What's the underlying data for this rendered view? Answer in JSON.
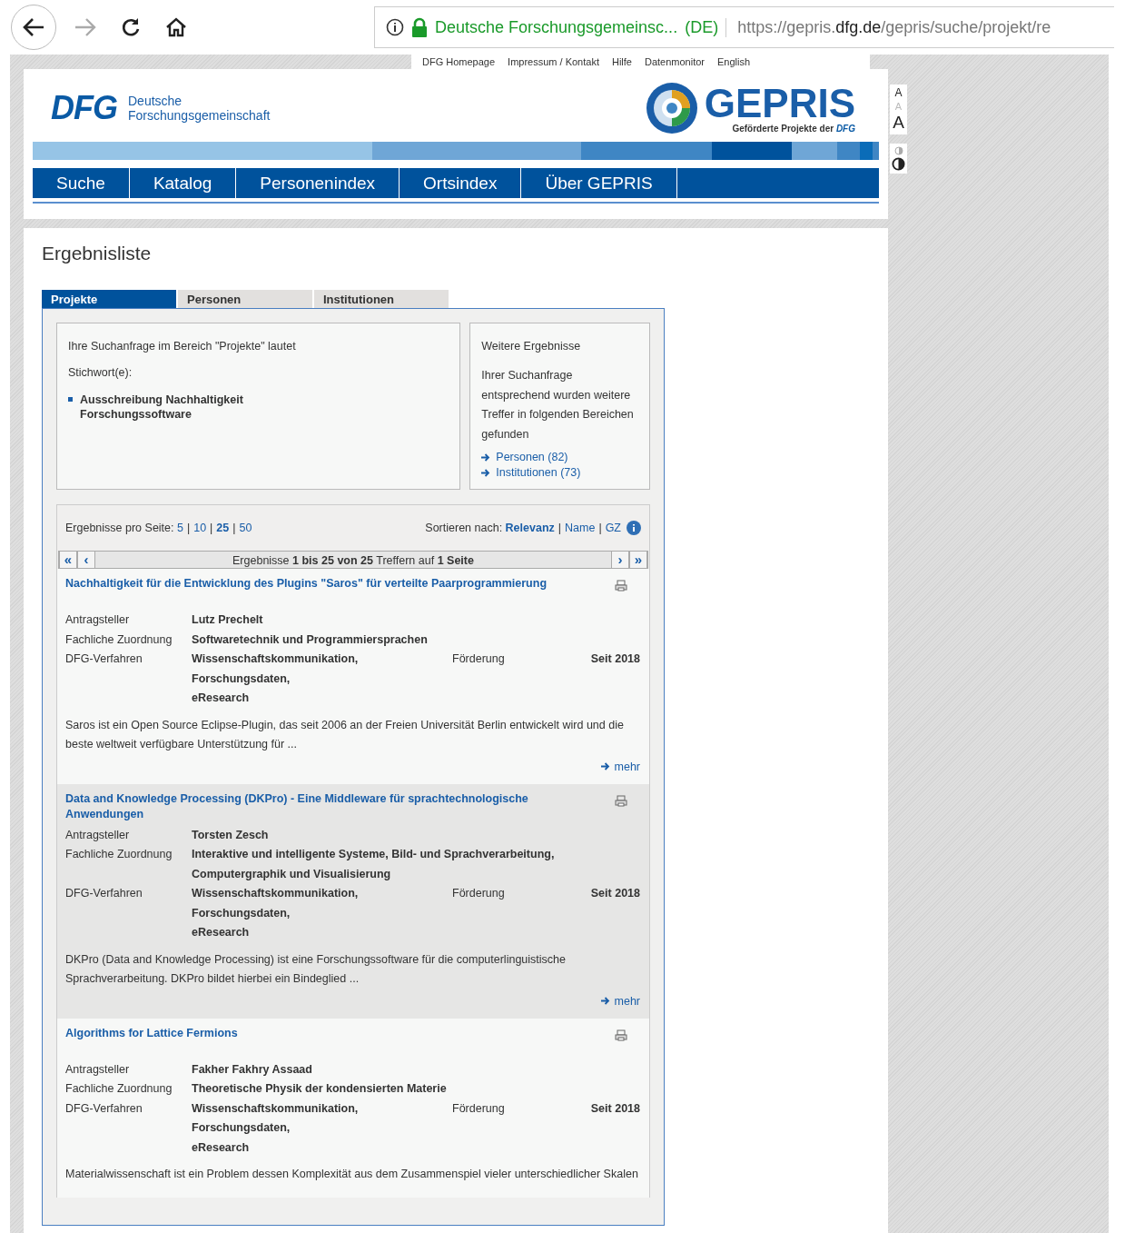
{
  "browser": {
    "site": "Deutsche Forschungsgemeinsc...",
    "country": "(DE)",
    "url_prefix": "https://gepris.",
    "url_domain": "dfg.de",
    "url_rest": "/gepris/suche/projekt/re"
  },
  "top_links": [
    "DFG Homepage",
    "Impressum / Kontakt",
    "Hilfe",
    "Datenmonitor",
    "English"
  ],
  "header": {
    "dfg_logo": "DFG",
    "org_line1": "Deutsche",
    "org_line2": "Forschungsgemeinschaft",
    "gepris": "GEPRIS",
    "tagline": "Geförderte Projekte der",
    "tagline_logo": "DFG"
  },
  "font_sizes": [
    {
      "label": "A",
      "disabled": false
    },
    {
      "label": "A",
      "disabled": true
    },
    {
      "label": "A",
      "disabled": false
    }
  ],
  "nav": [
    "Suche",
    "Katalog",
    "Personenindex",
    "Ortsindex",
    "Über GEPRIS"
  ],
  "page_title": "Ergebnisliste",
  "tabs": [
    {
      "label": "Projekte",
      "selected": true
    },
    {
      "label": "Personen",
      "selected": false
    },
    {
      "label": "Institutionen",
      "selected": false
    }
  ],
  "query": {
    "intro": "Ihre Suchanfrage im Bereich \"Projekte\" lautet",
    "keyword_label": "Stichwort(e):",
    "keyword_lines": [
      "Ausschreibung Nachhaltigkeit",
      "Forschungssoftware"
    ]
  },
  "more_results": {
    "title": "Weitere Ergebnisse",
    "text": "Ihrer Suchanfrage entsprechend wurden weitere Treffer in folgenden Bereichen gefunden",
    "links": [
      "Personen (82)",
      "Institutionen (73)"
    ]
  },
  "separator": "|",
  "per_page": {
    "label": "Ergebnisse pro Seite:",
    "options": [
      {
        "label": "5",
        "selected": false
      },
      {
        "label": "10",
        "selected": false
      },
      {
        "label": "25",
        "selected": true
      },
      {
        "label": "50",
        "selected": false
      }
    ]
  },
  "sort": {
    "label": "Sortieren nach:",
    "options": [
      {
        "label": "Relevanz",
        "selected": true
      },
      {
        "label": "Name",
        "selected": false
      },
      {
        "label": "GZ",
        "selected": false
      }
    ]
  },
  "pager": {
    "first": "«",
    "prev": "‹",
    "next": "›",
    "last": "»",
    "summary": "Ergebnisse **1 bis 25 von 25** Treffern auf **1 Seite**"
  },
  "results": [
    {
      "title": "Nachhaltigkeit für die Entwicklung des Plugins \"Saros\" für verteilte Paarprogrammierung",
      "fields": [
        {
          "label": "Antragsteller",
          "lines": [
            "Lutz Prechelt"
          ]
        },
        {
          "label": "Fachliche Zuordnung",
          "lines": [
            "Softwaretechnik und Programmiersprachen"
          ]
        },
        {
          "label": "DFG-Verfahren",
          "lines": [
            "Wissenschaftskommunikation,",
            "Forschungsdaten,",
            "eResearch"
          ]
        }
      ],
      "funding_label": "Förderung",
      "funding_value": "Seit 2018",
      "description": "Saros ist ein Open Source Eclipse-Plugin, das seit 2006 an der Freien Universität Berlin entwickelt wird und die beste weltweit verfügbare Unterstützung für ...",
      "more": "mehr"
    },
    {
      "title": "Data and Knowledge Processing (DKPro) - Eine Middleware für sprachtechnologische Anwendungen",
      "fields": [
        {
          "label": "Antragsteller",
          "lines": [
            "Torsten Zesch"
          ]
        },
        {
          "label": "Fachliche Zuordnung",
          "lines": [
            "Interaktive und intelligente Systeme, Bild- und Sprachverarbeitung,",
            "Computergraphik und Visualisierung"
          ]
        },
        {
          "label": "DFG-Verfahren",
          "lines": [
            "Wissenschaftskommunikation,",
            "Forschungsdaten,",
            "eResearch"
          ]
        }
      ],
      "funding_label": "Förderung",
      "funding_value": "Seit 2018",
      "description": "DKPro (Data and Knowledge Processing) ist eine Forschungssoftware für die computerlinguistische Sprachverarbeitung. DKPro bildet hierbei ein Bindeglied ...",
      "more": "mehr"
    },
    {
      "title": "Algorithms for Lattice Fermions",
      "fields": [
        {
          "label": "Antragsteller",
          "lines": [
            "Fakher Fakhry Assaad"
          ]
        },
        {
          "label": "Fachliche Zuordnung",
          "lines": [
            "Theoretische Physik der kondensierten Materie"
          ]
        },
        {
          "label": "DFG-Verfahren",
          "lines": [
            "Wissenschaftskommunikation,",
            "Forschungsdaten,",
            "eResearch"
          ]
        }
      ],
      "funding_label": "Förderung",
      "funding_value": "Seit 2018",
      "description": "Materialwissenschaft ist ein Problem dessen Komplexität aus dem Zusammenspiel vieler unterschiedlicher Skalen"
    }
  ]
}
